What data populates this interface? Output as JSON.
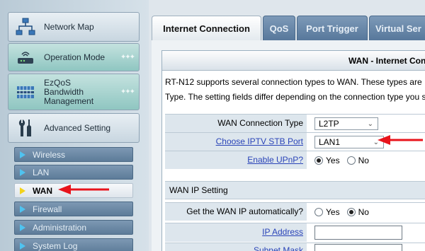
{
  "sidebar": {
    "main_items": [
      {
        "label": "Network Map",
        "icon": "network-map-icon"
      },
      {
        "label": "Operation Mode",
        "icon": "router-icon"
      },
      {
        "label_lines": [
          "EzQoS",
          "Bandwidth",
          "Management"
        ],
        "icon": "bandwidth-icon"
      },
      {
        "label": "Advanced Setting",
        "icon": "tools-icon"
      }
    ],
    "sub_items": [
      {
        "label": "Wireless"
      },
      {
        "label": "LAN"
      },
      {
        "label": "WAN"
      },
      {
        "label": "Firewall"
      },
      {
        "label": "Administration"
      },
      {
        "label": "System Log"
      }
    ],
    "active_sub_item": "WAN"
  },
  "tabs": [
    {
      "label": "Internet Connection"
    },
    {
      "label": "QoS"
    },
    {
      "label": "Port Trigger"
    },
    {
      "label": "Virtual Ser"
    }
  ],
  "panel": {
    "title": "WAN - Internet Con",
    "description_lines": [
      "RT-N12 supports several connection types to WAN. These types are",
      "Type. The setting fields differ depending on the connection type you s"
    ],
    "connection_type": {
      "label": "WAN Connection Type",
      "value": "L2TP"
    },
    "iptv_port": {
      "label": "Choose IPTV STB Port",
      "value": "LAN1"
    },
    "upnp": {
      "label": "Enable UPnP?",
      "options": [
        "Yes",
        "No"
      ],
      "selected": "Yes"
    },
    "wan_ip_section": {
      "title": "WAN IP Setting"
    },
    "wan_ip_auto": {
      "label": "Get the WAN IP automatically?",
      "options": [
        "Yes",
        "No"
      ],
      "selected": "No"
    },
    "ip_address": {
      "label": "IP Address",
      "value": ""
    },
    "subnet_mask": {
      "label": "Subnet Mask"
    }
  },
  "colors": {
    "annotation_arrow": "#e8141c",
    "link_label": "#2a44b8",
    "submenu_bg": "#5d7c99",
    "tab_active_bg": "#ffffff"
  }
}
